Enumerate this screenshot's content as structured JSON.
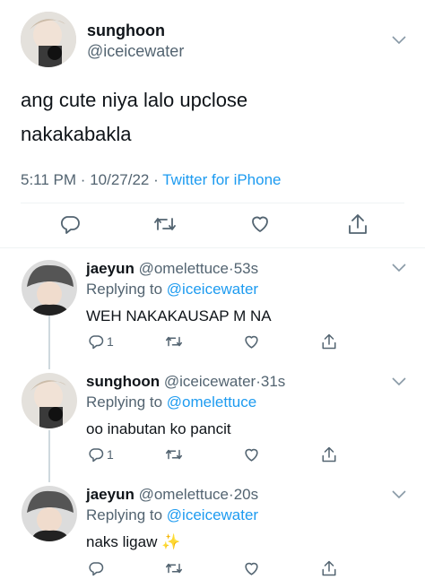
{
  "main_tweet": {
    "display_name": "sunghoon",
    "handle": "@iceicewater",
    "text_line1": "ang cute niya lalo upclose",
    "text_line2": "nakakabakla",
    "time": "5:11 PM",
    "sep1": "·",
    "date": "10/27/22",
    "sep2": "·",
    "source": "Twitter for iPhone"
  },
  "replies": [
    {
      "display_name": "jaeyun",
      "handle": "@omelettuce",
      "sep": "·",
      "age": "53s",
      "replying_prefix": "Replying to",
      "replying_to": "@iceicewater",
      "text": "WEH NAKAKAUSAP M NA",
      "reply_count": "1"
    },
    {
      "display_name": "sunghoon",
      "handle": "@iceicewater",
      "sep": "·",
      "age": "31s",
      "replying_prefix": "Replying to",
      "replying_to": "@omelettuce",
      "text": "oo inabutan ko pancit",
      "reply_count": "1"
    },
    {
      "display_name": "jaeyun",
      "handle": "@omelettuce",
      "sep": "·",
      "age": "20s",
      "replying_prefix": "Replying to",
      "replying_to": "@iceicewater",
      "text": "naks ligaw",
      "emoji": "✨",
      "reply_count": ""
    }
  ],
  "colors": {
    "link": "#1d9bf0",
    "muted": "#536471",
    "divider": "#eff3f4",
    "thread_line": "#cfd9de"
  }
}
